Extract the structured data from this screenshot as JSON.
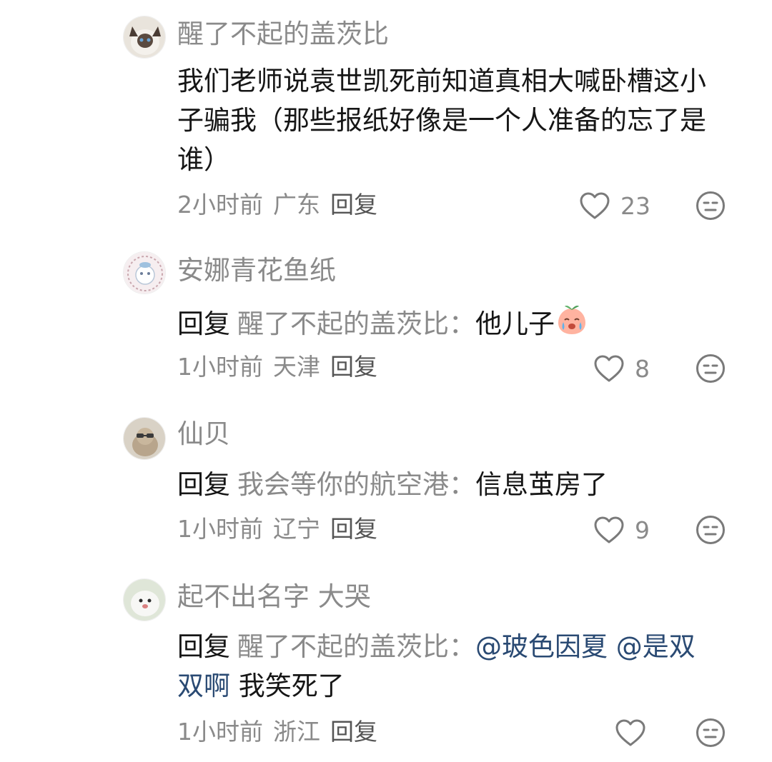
{
  "comments": [
    {
      "username": "醒了不起的盖茨比",
      "text": "我们老师说袁世凯死前知道真相大喊卧槽这小子骗我（那些报纸好像是一个人准备的忘了是谁）",
      "time": "2小时前",
      "location": "广东",
      "reply_label": "回复",
      "likes": "23"
    },
    {
      "username": "安娜青花鱼纸",
      "reply_prefix": "回复",
      "reply_target": "醒了不起的盖茨比：",
      "text": "他儿子",
      "emoji": "crying-peach-emoji",
      "time": "1小时前",
      "location": "天津",
      "reply_label": "回复",
      "likes": "8"
    },
    {
      "username": "仙贝",
      "reply_prefix": "回复",
      "reply_target": "我会等你的航空港：",
      "text": "信息茧房了",
      "time": "1小时前",
      "location": "辽宁",
      "reply_label": "回复",
      "likes": "9"
    },
    {
      "username": "起不出名字 大哭",
      "reply_prefix": "回复",
      "reply_target": "醒了不起的盖茨比：",
      "mention1": "@玻色因夏",
      "mention2": "@是双双啊",
      "text": "我笑死了",
      "time": "1小时前",
      "location": "浙江",
      "reply_label": "回复",
      "likes": ""
    }
  ],
  "colors": {
    "text": "#161616",
    "muted": "#8a8a8a",
    "mention": "#2a4a73"
  }
}
